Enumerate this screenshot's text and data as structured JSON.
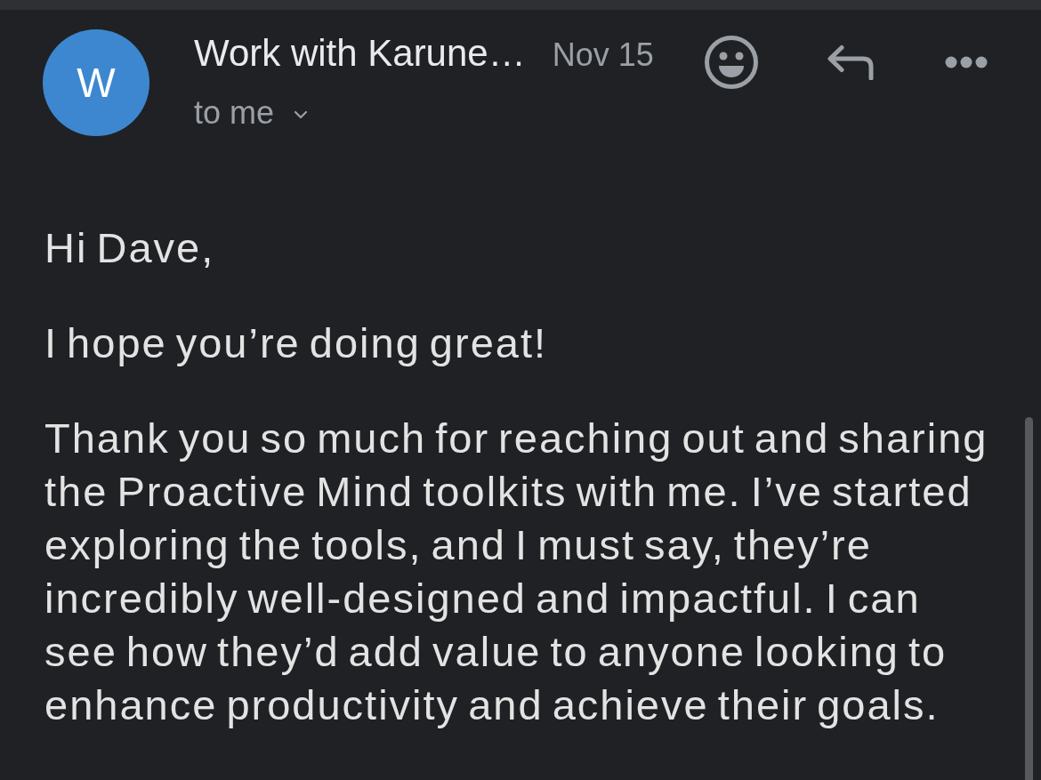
{
  "message_header": {
    "avatar_letter": "W",
    "sender": "Work with Karune…",
    "date": "Nov 15",
    "recipient": "to me"
  },
  "body": {
    "paragraphs": [
      "Hi Dave,",
      "I hope you’re doing great!",
      "Thank you so much for reaching out and sharing the Proactive Mind toolkits with me. I’ve started exploring the tools, and I must say, they’re incredibly well-designed and impactful. I can see how they’d add value to anyone looking to enhance productivity and achieve their goals."
    ]
  }
}
